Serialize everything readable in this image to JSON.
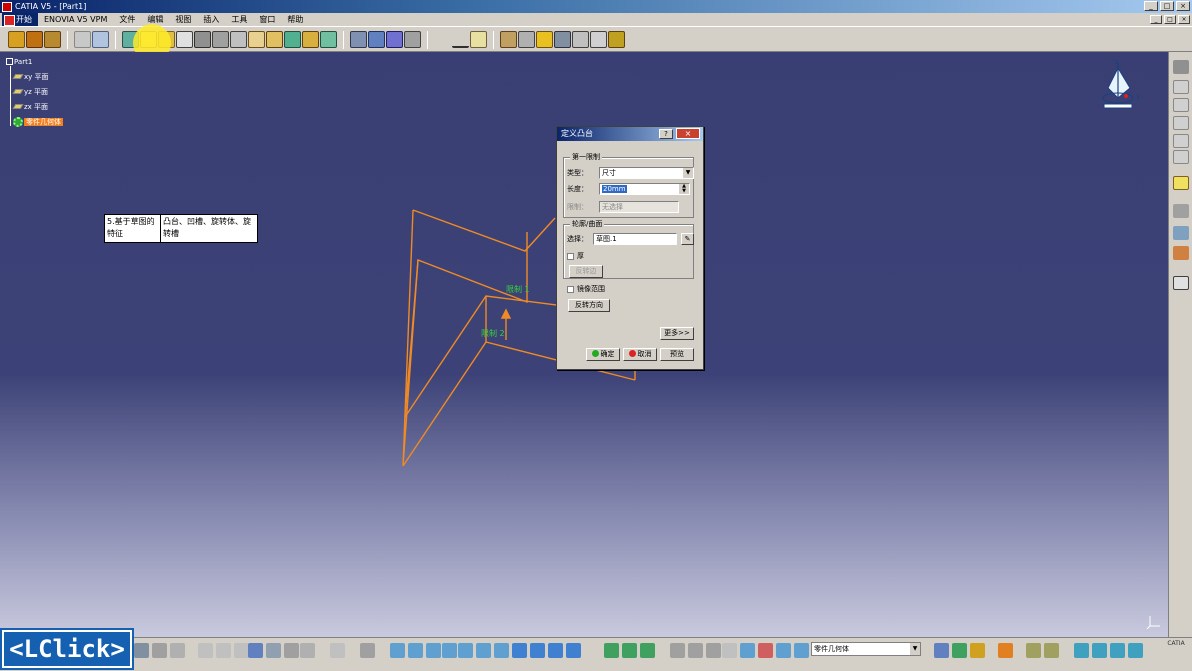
{
  "window": {
    "title": "CATIA V5 - [Part1]",
    "controls": [
      "_",
      "□",
      "×"
    ]
  },
  "menu": {
    "start": "开始",
    "items": [
      "ENOVIA V5 VPM",
      "文件",
      "编辑",
      "视图",
      "插入",
      "工具",
      "窗口",
      "帮助"
    ]
  },
  "tree": {
    "root": "Part1",
    "planes": [
      "xy 平面",
      "yz 平面",
      "zx 平面"
    ],
    "body": "零件几何体"
  },
  "note": {
    "col1": "5.基于草图的特征",
    "col2": "凸台、凹槽、旋转体、旋转槽"
  },
  "geometry_labels": {
    "limit1": "限制 1",
    "limit2": "限制 2"
  },
  "dialog": {
    "title": "定义凸台",
    "help": "?",
    "close": "×",
    "first_limit": {
      "group": "第一限制",
      "type_label": "类型：",
      "type_value": "尺寸",
      "length_label": "长度：",
      "length_value": "20mm",
      "limit_label": "限制：",
      "limit_value": "无选择"
    },
    "profile": {
      "group": "轮廓/曲面",
      "select_label": "选择：",
      "select_value": "草图.1",
      "thick_label": "厚",
      "reverse_side": "反转边"
    },
    "mirror_label": "镜像范围",
    "reverse_direction": "反转方向",
    "more": "更多>>",
    "ok": "确定",
    "cancel": "取消",
    "preview": "预览"
  },
  "bottom": {
    "body_combo": "零件几何体"
  },
  "overlay": {
    "click_hint": "<LClick>"
  },
  "logo": "CATIA",
  "colors": {
    "viewport_top": "#3a3f73",
    "wire": "#f08a24",
    "label_green": "#36d23a"
  }
}
